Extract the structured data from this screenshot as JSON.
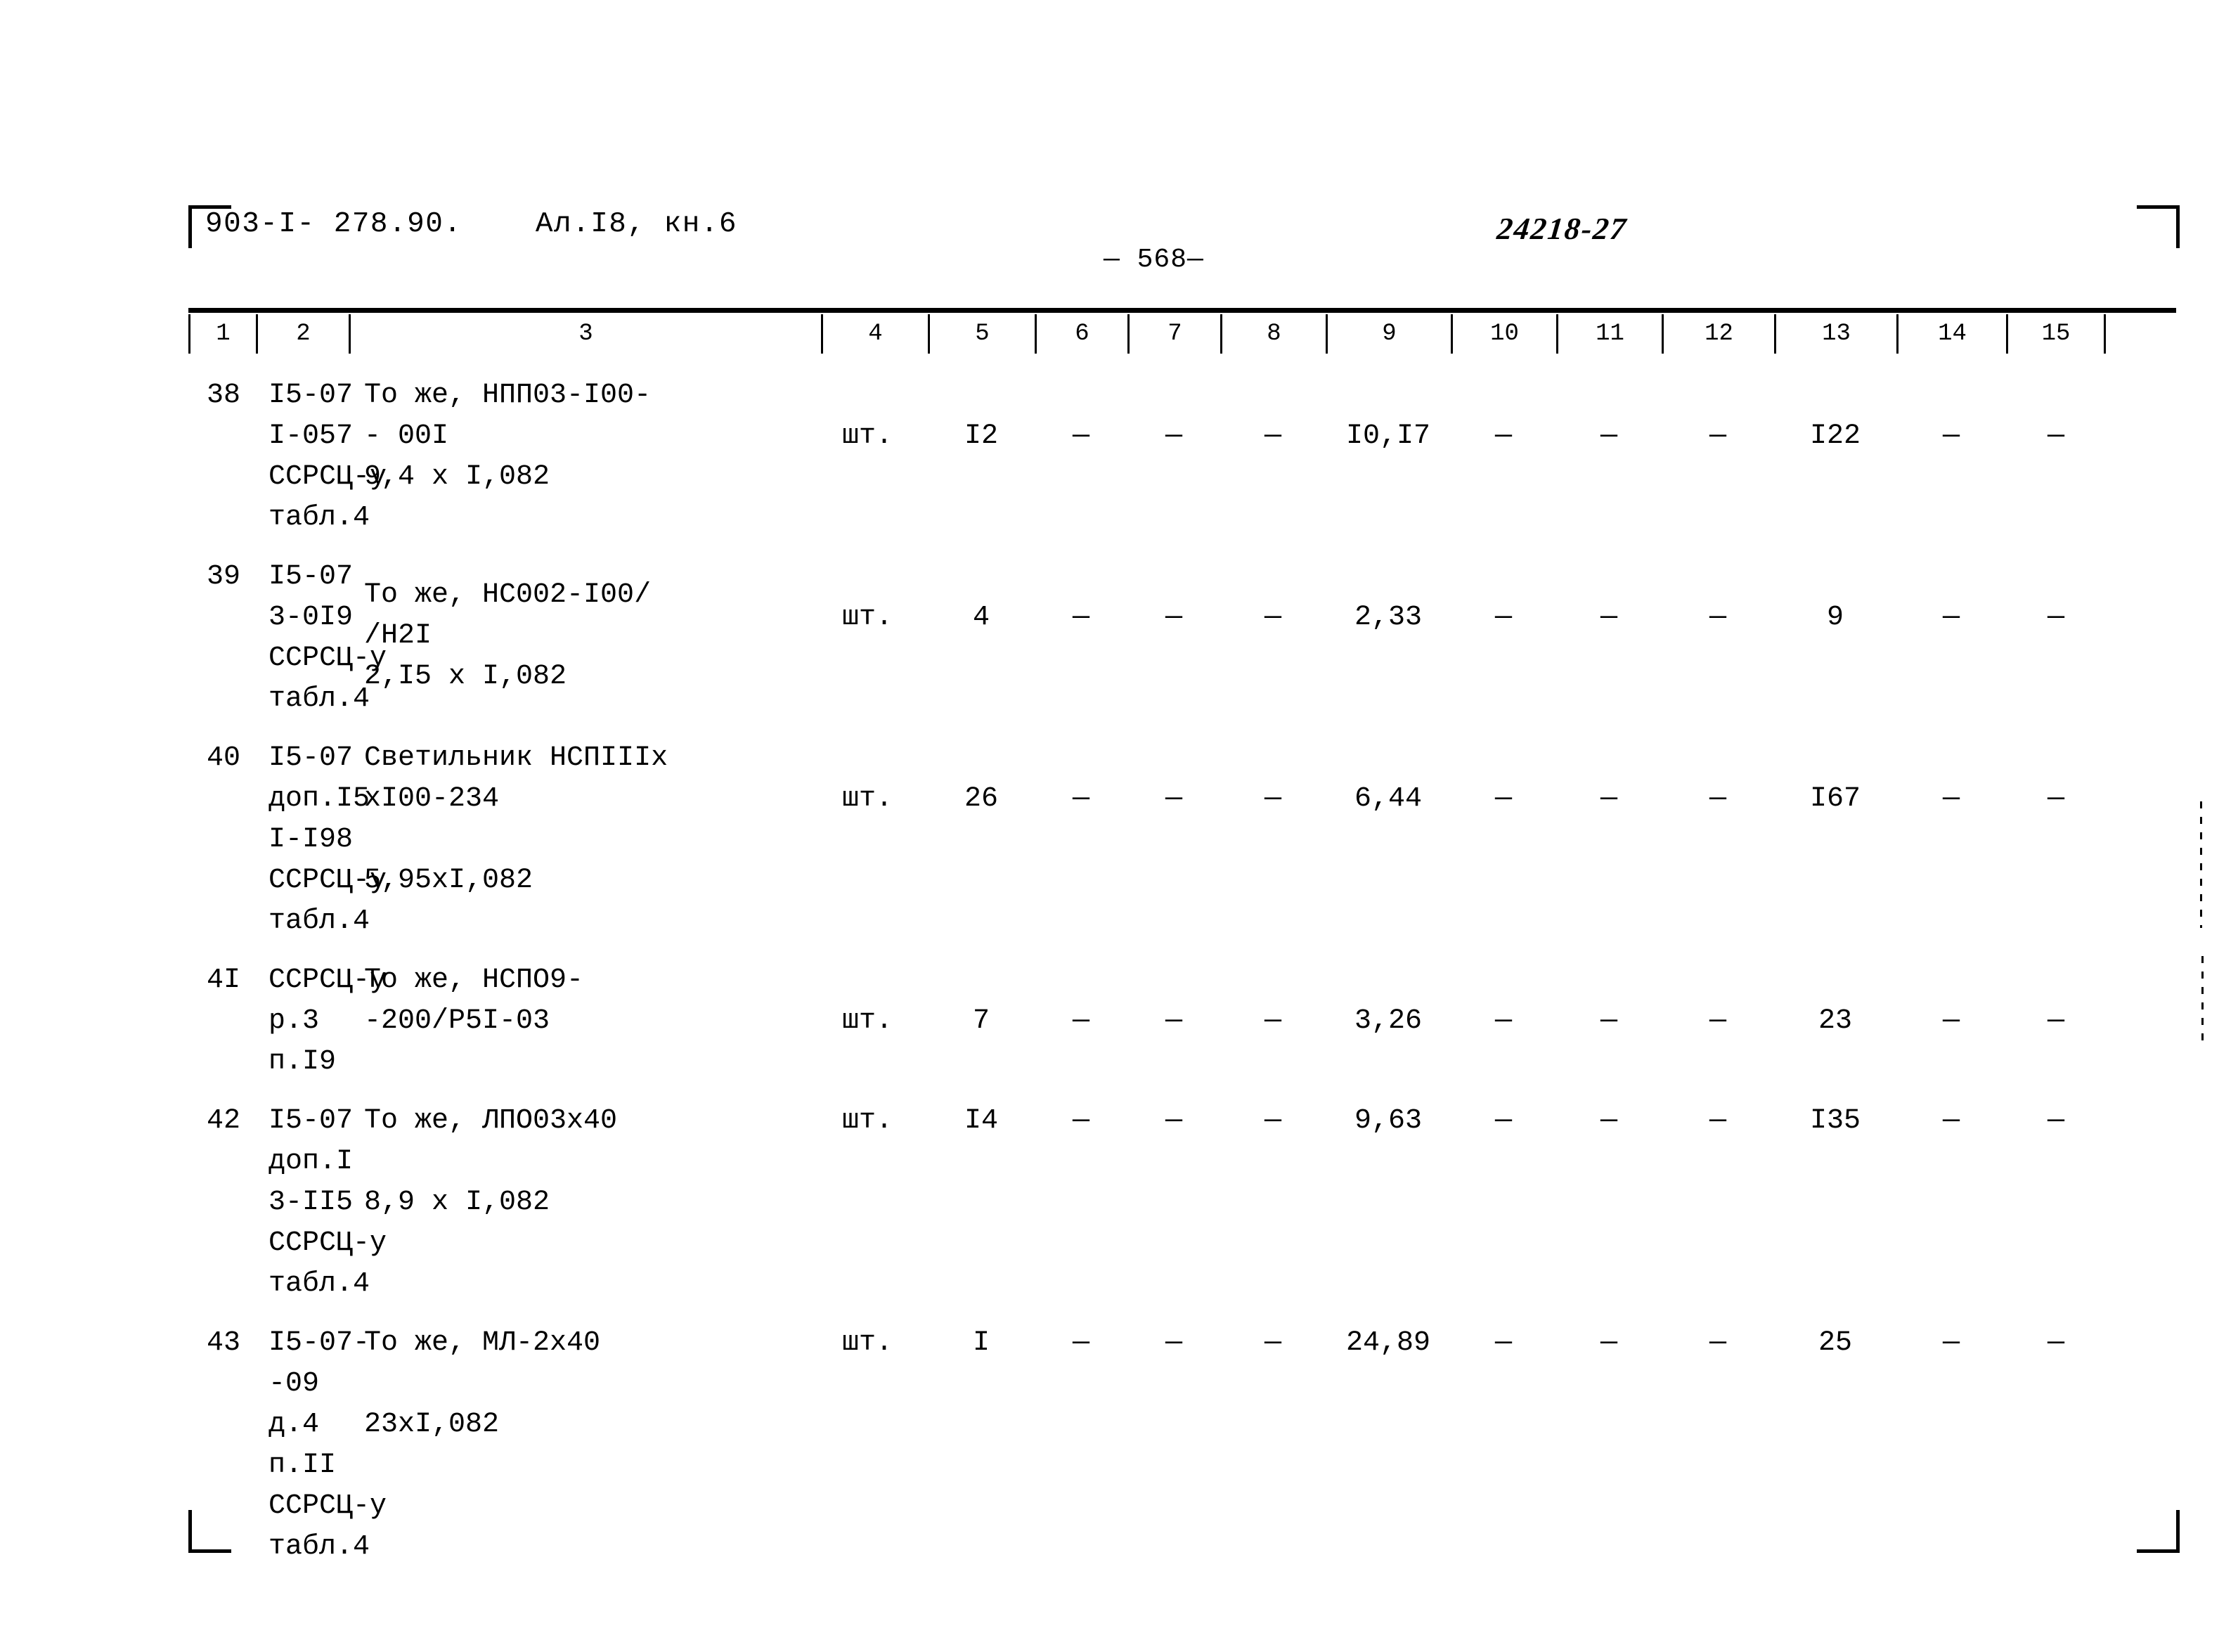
{
  "header": {
    "doc_code": "903-I- 278.90.",
    "album": "Ал.I8, кн.6",
    "page_number": "— 568—",
    "stamp": "24218-27"
  },
  "table": {
    "column_headers": [
      "1",
      "2",
      "3",
      "4",
      "5",
      "6",
      "7",
      "8",
      "9",
      "10",
      "11",
      "12",
      "13",
      "14",
      "15"
    ],
    "rows": [
      {
        "no": "38",
        "code_lines": [
          "I5-07",
          "I-057",
          "ССРСЦ-у",
          "табл.4"
        ],
        "desc_lines": [
          "То же, НПП03-I00-",
          "- 00I",
          "",
          "9,4 х I,082"
        ],
        "unit": "шт.",
        "qty": "I2",
        "c6": "—",
        "c7": "—",
        "c8": "—",
        "c9": "I0,I7",
        "c10": "—",
        "c11": "—",
        "c12": "—",
        "c13": "I22",
        "c14": "—",
        "c15": "—"
      },
      {
        "no": "39",
        "code_lines": [
          "I5-07",
          "3-0I9",
          "ССРСЦ-у",
          "табл.4"
        ],
        "desc_lines": [
          "",
          "То же, НС002-I00/",
          "/Н2I",
          "2,I5 х I,082"
        ],
        "unit": "шт.",
        "qty": "4",
        "c6": "—",
        "c7": "—",
        "c8": "—",
        "c9": "2,33",
        "c10": "—",
        "c11": "—",
        "c12": "—",
        "c13": "9",
        "c14": "—",
        "c15": "—"
      },
      {
        "no": "40",
        "code_lines": [
          "I5-07",
          "доп.I5",
          "I-I98",
          "ССРСЦ-у",
          "табл.4"
        ],
        "desc_lines": [
          "Светильник НСПIIIх",
          "хI00-234",
          "",
          "5,95хI,082",
          ""
        ],
        "unit": "шт.",
        "qty": "26",
        "c6": "—",
        "c7": "—",
        "c8": "—",
        "c9": "6,44",
        "c10": "—",
        "c11": "—",
        "c12": "—",
        "c13": "I67",
        "c14": "—",
        "c15": "—"
      },
      {
        "no": "4I",
        "code_lines": [
          "ССРСЦ-у",
          "р.3",
          "п.I9"
        ],
        "desc_lines": [
          "То же, НСПО9-",
          "-200/Р5I-03",
          ""
        ],
        "unit": "шт.",
        "qty": "7",
        "c6": "—",
        "c7": "—",
        "c8": "—",
        "c9": "3,26",
        "c10": "—",
        "c11": "—",
        "c12": "—",
        "c13": "23",
        "c14": "—",
        "c15": "—"
      },
      {
        "no": "42",
        "code_lines": [
          "I5-07",
          "доп.I",
          "3-II5",
          "ССРСЦ-у",
          "табл.4"
        ],
        "desc_lines": [
          "То же, ЛПО03х40",
          "",
          "8,9 х I,082",
          "",
          ""
        ],
        "unit": "шт.",
        "qty": "I4",
        "c6": "—",
        "c7": "—",
        "c8": "—",
        "c9": "9,63",
        "c10": "—",
        "c11": "—",
        "c12": "—",
        "c13": "I35",
        "c14": "—",
        "c15": "—"
      },
      {
        "no": "43",
        "code_lines": [
          "I5-07-",
          "-09",
          "д.4",
          "п.II",
          "ССРСЦ-у",
          "табл.4"
        ],
        "desc_lines": [
          "То же, МЛ-2х40",
          "",
          "23хI,082",
          "",
          "",
          ""
        ],
        "unit": "шт.",
        "qty": "I",
        "c6": "—",
        "c7": "—",
        "c8": "—",
        "c9": "24,89",
        "c10": "—",
        "c11": "—",
        "c12": "—",
        "c13": "25",
        "c14": "—",
        "c15": "—"
      }
    ]
  }
}
